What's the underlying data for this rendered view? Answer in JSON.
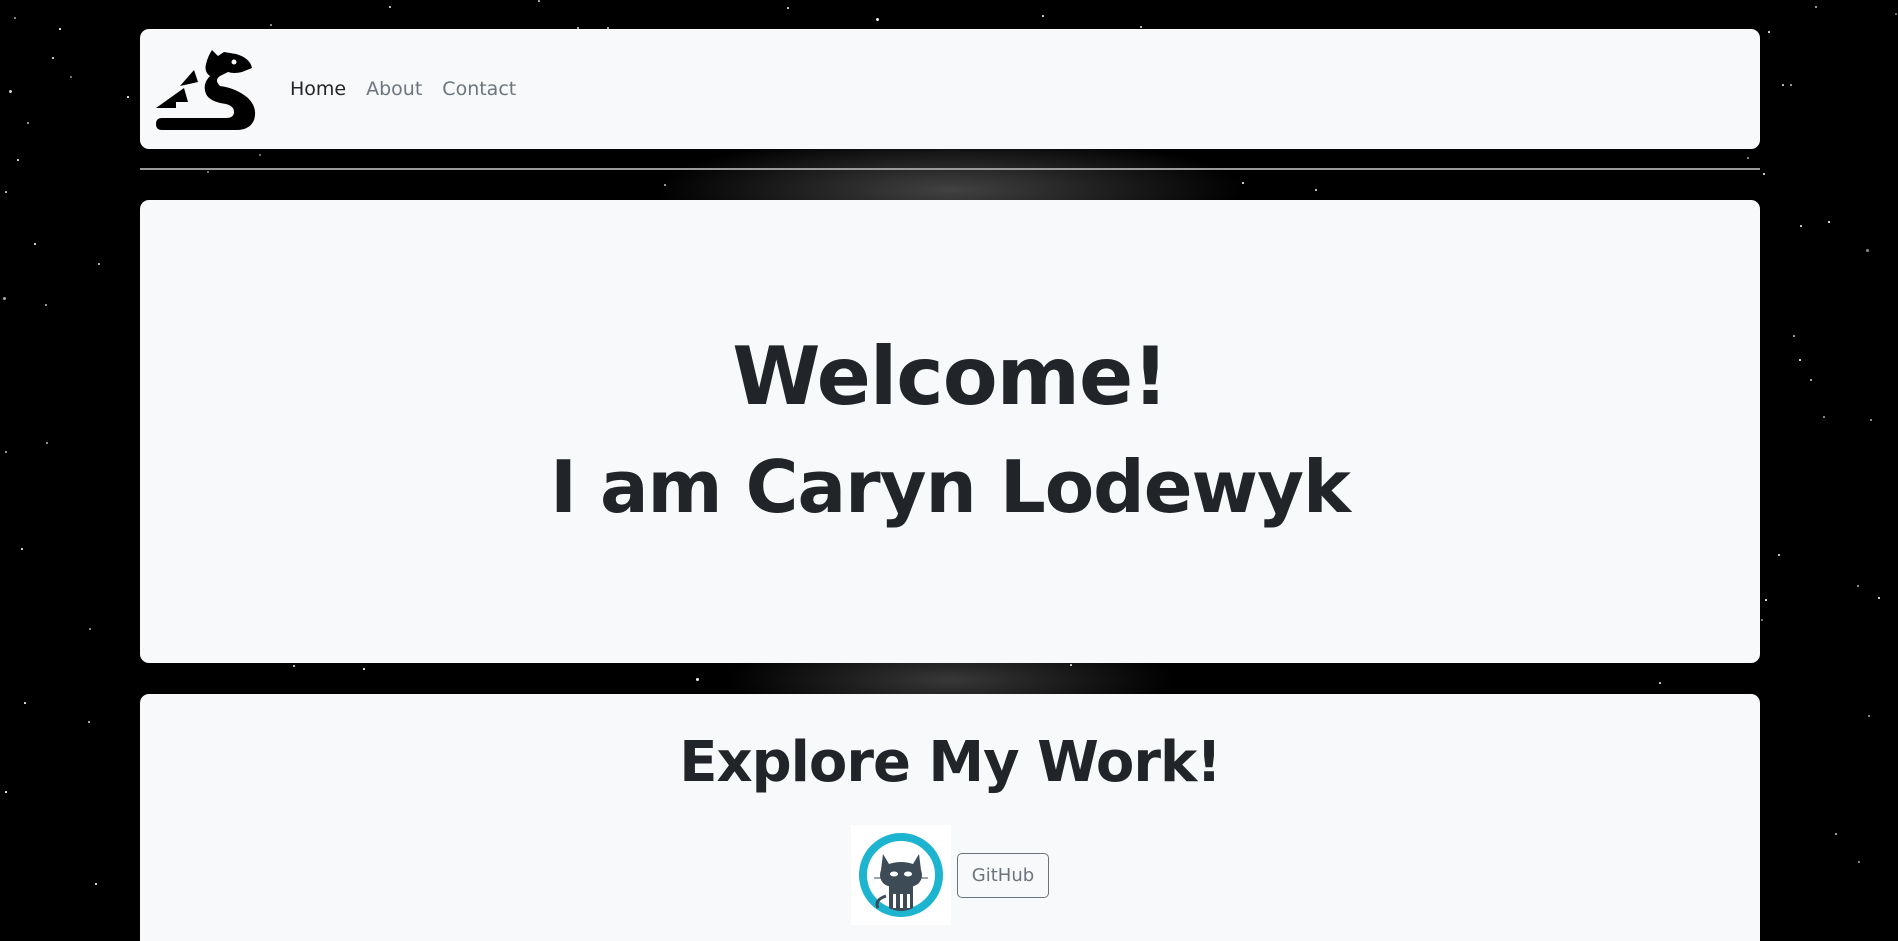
{
  "nav": {
    "logo_icon": "dragon-logo-icon",
    "links": [
      {
        "label": "Home",
        "active": true
      },
      {
        "label": "About",
        "active": false
      },
      {
        "label": "Contact",
        "active": false
      }
    ]
  },
  "hero": {
    "title": "Welcome!",
    "subtitle": "I am Caryn Lodewyk"
  },
  "work": {
    "heading": "Explore My Work!",
    "github_icon": "github-octocat-icon",
    "github_label": "GitHub"
  },
  "colors": {
    "card_bg": "#f8f9fa",
    "text": "#212529",
    "muted": "#6c757d",
    "github_ring": "#1cb4cf"
  }
}
